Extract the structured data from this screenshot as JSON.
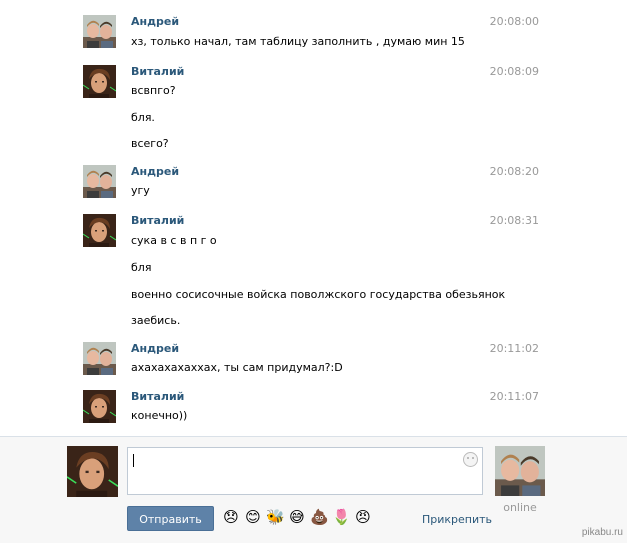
{
  "messages": [
    {
      "author": "Андрей",
      "time": "20:08:00",
      "avatar": "andrey",
      "lines": [
        "хз, только начал, там таблицу заполнить , думаю мин 15"
      ]
    },
    {
      "author": "Виталий",
      "time": "20:08:09",
      "avatar": "vitaliy",
      "lines": [
        "всвпго?",
        "бля.",
        "всего?"
      ]
    },
    {
      "author": "Андрей",
      "time": "20:08:20",
      "avatar": "andrey",
      "lines": [
        "угу"
      ]
    },
    {
      "author": "Виталий",
      "time": "20:08:31",
      "avatar": "vitaliy",
      "lines": [
        "сука в с в п г о",
        "бля",
        "военно сосисочные войска поволжского государства обезьянок",
        "заебись."
      ]
    },
    {
      "author": "Андрей",
      "time": "20:11:02",
      "avatar": "andrey",
      "lines": [
        "ахахахахаххах, ты сам придумал?:D"
      ]
    },
    {
      "author": "Виталий",
      "time": "20:11:07",
      "avatar": "vitaliy",
      "lines": [
        "конечно))"
      ]
    }
  ],
  "composer": {
    "input_value": "",
    "send_label": "Отправить",
    "attach_label": "Прикрепить",
    "peer_status": "online",
    "emoji": [
      "😞",
      "😊",
      "🐝",
      "😅",
      "💩",
      "🌷",
      "😠"
    ]
  },
  "watermark": "pikabu.ru",
  "colors": {
    "link": "#2b587a",
    "button": "#5e82a8",
    "time": "#999999"
  }
}
